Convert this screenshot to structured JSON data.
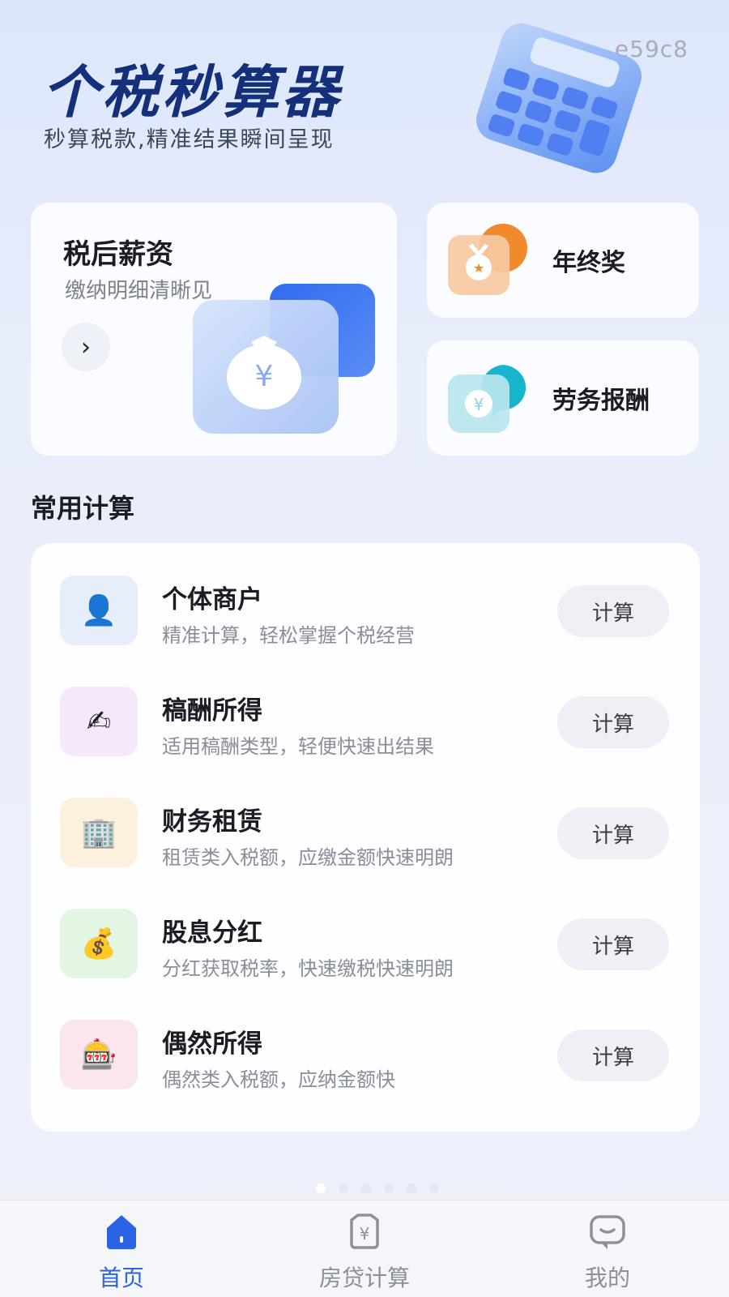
{
  "watermark": "e59c8",
  "header": {
    "title": "个税秒算器",
    "subtitle": "秒算税款,精准结果瞬间呈现"
  },
  "feature_cards": {
    "salary": {
      "title": "税后薪资",
      "subtitle": "缴纳明细清晰见",
      "icon": "money-bag-icon"
    },
    "bonus": {
      "label": "年终奖",
      "icon": "medal-icon",
      "accent": "#f08a2a"
    },
    "labor": {
      "label": "劳务报酬",
      "icon": "yuan-coin-icon",
      "accent": "#18b5cf"
    }
  },
  "section": {
    "title": "常用计算"
  },
  "calc_list": [
    {
      "title": "个体商户",
      "desc": "精准计算，轻松掌握个税经营",
      "icon": "person-icon",
      "button": "计算",
      "bg": "#e6eefb"
    },
    {
      "title": "稿酬所得",
      "desc": "适用稿酬类型，轻便快速出结果",
      "icon": "writing-hand-icon",
      "button": "计算",
      "bg": "#f4e8fa"
    },
    {
      "title": "财务租赁",
      "desc": "租赁类入税额，应缴金额快速明朗",
      "icon": "office-building-icon",
      "button": "计算",
      "bg": "#fdf0dc"
    },
    {
      "title": "股息分红",
      "desc": "分红获取税率，快速缴税快速明朗",
      "icon": "money-bag-dollar-icon",
      "button": "计算",
      "bg": "#e3f5e3"
    },
    {
      "title": "偶然所得",
      "desc": "偶然类入税额，应纳金额快",
      "icon": "slot-machine-icon",
      "button": "计算",
      "bg": "#fbe6ec"
    }
  ],
  "tabbar": {
    "tabs": [
      {
        "label": "首页",
        "icon": "home-icon",
        "active": true
      },
      {
        "label": "房贷计算",
        "icon": "yuan-shield-icon",
        "active": false
      },
      {
        "label": "我的",
        "icon": "chat-smile-icon",
        "active": false
      }
    ],
    "active_color": "#2b63e6"
  },
  "colors": {
    "brand_blue": "#2b63e6",
    "title_navy": "#14307a"
  }
}
